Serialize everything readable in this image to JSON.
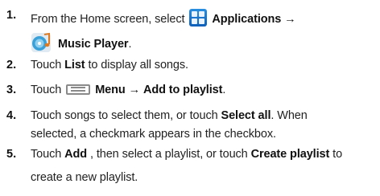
{
  "steps": [
    {
      "number": "1.",
      "line1_prefix": "From the Home screen, select",
      "applications_label": "Applications",
      "arrow": "→",
      "music_player_label": "Music Player",
      "period": "."
    },
    {
      "number": "2.",
      "prefix": "Touch",
      "bold": "List",
      "suffix": "to display all songs."
    },
    {
      "number": "3.",
      "prefix": "Touch",
      "menu_label": "Menu",
      "arrow": "→",
      "add_label": "Add to playlist",
      "period": "."
    },
    {
      "number": "4.",
      "line1_prefix": "Touch songs to select them, or touch",
      "select_all": "Select all",
      "line1_suffix": ". When",
      "line2": "selected, a checkmark appears in the checkbox."
    },
    {
      "number": "5.",
      "prefix": "Touch",
      "add": "Add",
      "middle": ", then select a playlist, or touch",
      "create_playlist": "Create playlist",
      "suffix": "to",
      "line2": "create a new playlist."
    }
  ],
  "icons": {
    "applications": "applications-grid-icon",
    "music_player": "music-player-icon",
    "menu": "menu-key-icon"
  },
  "colors": {
    "applications_icon": "#1a7ad0",
    "music_icon_disc": "#3aa0d8",
    "music_icon_note": "#e07a20"
  }
}
